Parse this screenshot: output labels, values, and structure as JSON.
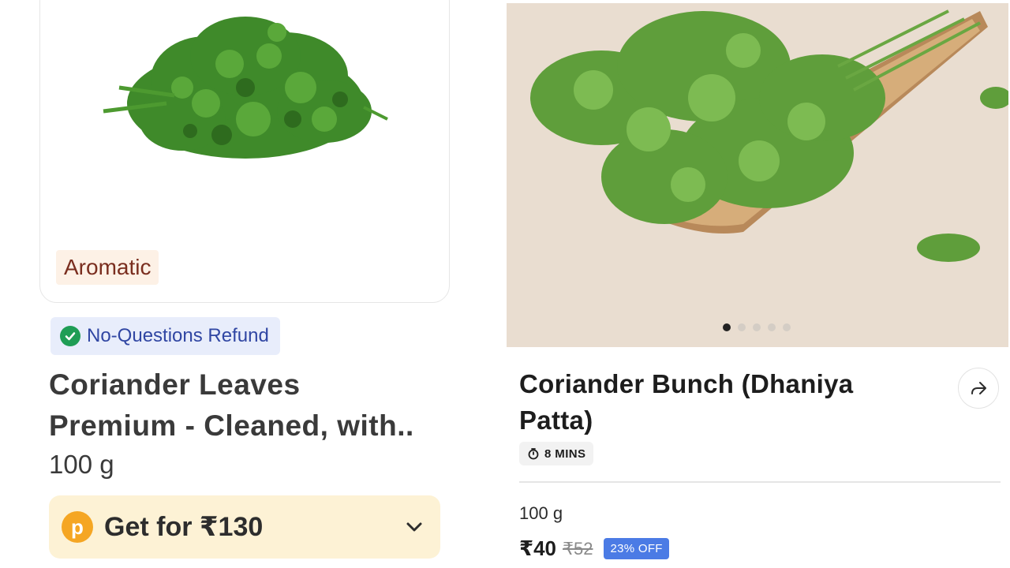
{
  "left_listing": {
    "tag": "Aromatic",
    "refund_label": "No-Questions Refund",
    "title_line1": "Coriander Leaves",
    "title_line2": "Premium - Cleaned, with..",
    "weight": "100 g",
    "offer_badge_letter": "p",
    "offer_label": "Get for ₹130"
  },
  "right_listing": {
    "carousel": {
      "total": 5,
      "active": 1
    },
    "title_line1": "Coriander Bunch (Dhaniya",
    "title_line2": "Patta)",
    "delivery_eta": "8 MINS",
    "weight": "100 g",
    "price": "₹40",
    "mrp": "₹52",
    "discount": "23% OFF"
  },
  "colors": {
    "refund_bg": "#e8edfb",
    "refund_text": "#3046a3",
    "offer_bg": "#fdf2d5",
    "offer_badge": "#f5a623",
    "discount_badge": "#4b7be5",
    "check_green": "#1f9d55"
  },
  "icons": {
    "refund": "check-circle-icon",
    "offer_chevron": "chevron-down-icon",
    "share": "share-arrow-icon",
    "eta": "stopwatch-icon"
  }
}
